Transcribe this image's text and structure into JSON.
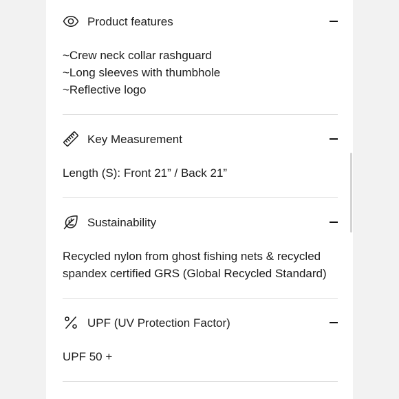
{
  "sections": [
    {
      "icon": "eye-icon",
      "title": "Product features",
      "lines": [
        "~Crew neck collar rashguard",
        "~Long sleeves with thumbhole",
        "~Reflective logo"
      ],
      "expanded": true
    },
    {
      "icon": "ruler-icon",
      "title": "Key Measurement",
      "lines": [
        "Length (S): Front 21” / Back 21”"
      ],
      "expanded": true
    },
    {
      "icon": "leaf-icon",
      "title": "Sustainability",
      "lines": [
        "Recycled nylon from ghost fishing nets & recycled",
        "spandex certified GRS (Global Recycled Standard)"
      ],
      "expanded": true
    },
    {
      "icon": "percent-icon",
      "title": "UPF (UV Protection Factor)",
      "lines": [
        "UPF 50 +"
      ],
      "expanded": true
    }
  ]
}
